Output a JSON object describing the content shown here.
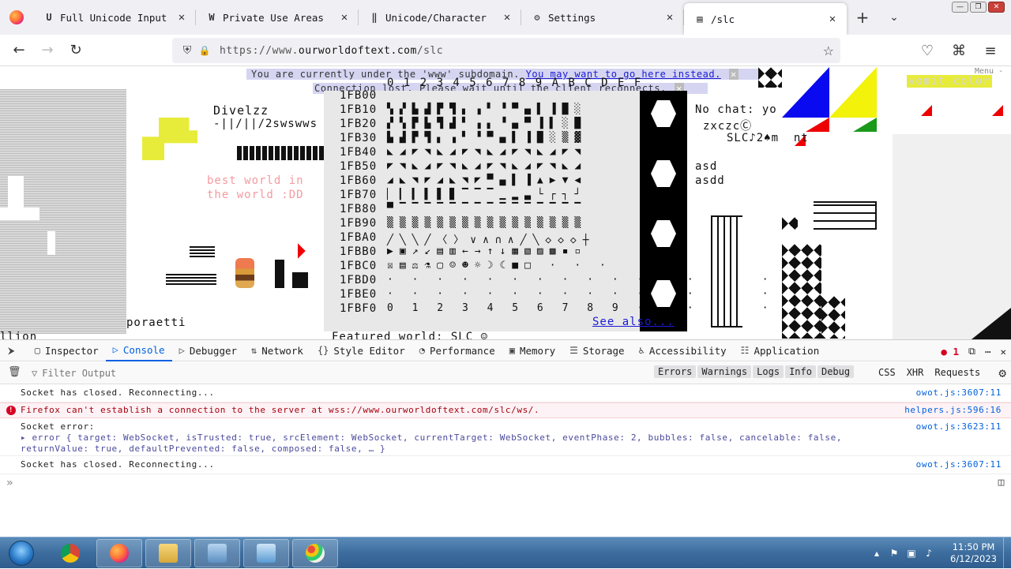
{
  "window_controls": [
    "—",
    "❐",
    "✕"
  ],
  "tabs": [
    {
      "label": "Full Unicode Input",
      "icon": "unicode-input-icon",
      "glyph": "U",
      "active": false
    },
    {
      "label": "Private Use Areas",
      "icon": "wikipedia-icon",
      "glyph": "W",
      "active": false
    },
    {
      "label": "Unicode/Character",
      "icon": "wiki-icon",
      "glyph": "‖",
      "active": false
    },
    {
      "label": "Settings",
      "icon": "gear-icon",
      "glyph": "⚙",
      "active": false
    },
    {
      "label": "/slc",
      "icon": "owot-icon",
      "glyph": "▤",
      "active": true
    }
  ],
  "tab_close": "✕",
  "tab_add": "+",
  "tab_list": "⌄",
  "nav": {
    "back": "←",
    "forward": "→",
    "reload": "↻",
    "url_prefix": "https://www.",
    "url_domain": "ourworldoftext.com",
    "url_path": "/slc",
    "shield": "⛨",
    "lock": "🔒",
    "star": "☆",
    "pocket": "♡",
    "extensions": "⌘",
    "menu": "≡"
  },
  "page": {
    "banner_text": "You are currently under the 'www' subdomain.",
    "banner_link": "You may want to go here instead.",
    "banner2_text": "Connection lost. Please wait until the client reconnects.",
    "banner_close": "✕",
    "divelzz": "Divelzz",
    "divelzz_sub": "-||/||/2swswws",
    "best_world_1": "best world in",
    "best_world_2": "the world :DD",
    "poraetti": "poraetti",
    "llion": "llion",
    "featured": "Featured world: SLC ☺",
    "see_also": "See also...",
    "no_chat": "No chat: yo",
    "zxczc": "zxczcⒸ",
    "slc_line": "SLC♪2♠m  nt",
    "asd": "asd",
    "asdd": "asdd",
    "vomit": "vomit color",
    "menu_label": "Menu -",
    "header_row": "0 1 2 3 4 5 6 7 8 9 A B C D E F",
    "rows": [
      {
        "code": "1FB00",
        "glyphs": ""
      },
      {
        "code": "1FB10",
        "glyphs": "▚▞▙▟▛▜▖▗▘▝▀▄▌▐█░"
      },
      {
        "code": "1FB20",
        "glyphs": "▞▚▛▙▜▟▘▗▖▝▄▀▐▌░█"
      },
      {
        "code": "1FB30",
        "glyphs": "▙▟▛▜▖▗▘▝▀▄▌▐█░▒▓"
      },
      {
        "code": "1FB40",
        "glyphs": "◣◢◤◥◣◢◤◥◣◢◤◥◣◢◤◥"
      },
      {
        "code": "1FB50",
        "glyphs": "◤◥◣◢◤◥◣◢◤◥◣◢◤◥◣◢"
      },
      {
        "code": "1FB60",
        "glyphs": "◢◣◥◤◢◣◥◤▀▄▌▐▲▶▼◀"
      },
      {
        "code": "1FB70",
        "glyphs": "▏▎▍▌▋▊▔▔▔▁▂▃└┌┐┘"
      },
      {
        "code": "1FB80",
        "glyphs": "▀▔▔▔▔▔▔▔▔▔▔▔▔▔▔▔"
      },
      {
        "code": "1FB90",
        "glyphs": "▒▒▒▒▒▒▒▒▒▒▒▒▒▒▒▒"
      },
      {
        "code": "1FBA0",
        "glyphs": "╱╲╲╱〈〉∨∧∩∧╱╲◇◇◇┼"
      },
      {
        "code": "1FBB0",
        "glyphs": "▶▣↗↙▤▥←→↑↓▦▧▨▩▪▫"
      },
      {
        "code": "1FBC0",
        "glyphs": "☒▤⚖⚗▢☺☻☼☽☾■□ · · ·"
      },
      {
        "code": "1FBD0",
        "glyphs": "· · · · · · · · · · · · · · · ·"
      },
      {
        "code": "1FBE0",
        "glyphs": "· · · · · · · · · · · · · · · ·"
      },
      {
        "code": "1FBF0",
        "glyphs": "0 1 2 3 4 5 6 7 8 9 · · · · · ·"
      }
    ]
  },
  "devtools": {
    "tabs": [
      {
        "label": "Inspector",
        "icon": "▢",
        "name": "inspector"
      },
      {
        "label": "Console",
        "icon": "▷",
        "name": "console",
        "active": true
      },
      {
        "label": "Debugger",
        "icon": "▷",
        "name": "debugger"
      },
      {
        "label": "Network",
        "icon": "⇅",
        "name": "network"
      },
      {
        "label": "Style Editor",
        "icon": "{}",
        "name": "style-editor"
      },
      {
        "label": "Performance",
        "icon": "◔",
        "name": "performance"
      },
      {
        "label": "Memory",
        "icon": "▣",
        "name": "memory"
      },
      {
        "label": "Storage",
        "icon": "☰",
        "name": "storage"
      },
      {
        "label": "Accessibility",
        "icon": "♿",
        "name": "accessibility"
      },
      {
        "label": "Application",
        "icon": "☷",
        "name": "application"
      }
    ],
    "error_count": "1",
    "pick_icon": "⮞",
    "filter_placeholder": "Filter Output",
    "filter_buttons": [
      "Errors",
      "Warnings",
      "Logs",
      "Info",
      "Debug"
    ],
    "filter_buttons2": [
      "CSS",
      "XHR",
      "Requests"
    ],
    "messages": [
      {
        "type": "log",
        "text": "Socket has closed. Reconnecting...",
        "source": "owot.js:3607:11"
      },
      {
        "type": "error",
        "text": "Firefox can't establish a connection to the server at wss://www.ourworldoftext.com/slc/ws/.",
        "source": "helpers.js:596:16"
      },
      {
        "type": "log",
        "text": "Socket error:",
        "source": "owot.js:3623:11",
        "detail_1": "▸ error { target: WebSocket, isTrusted: true, srcElement: WebSocket, currentTarget: WebSocket, eventPhase: 2, bubbles: false, cancelable: false,",
        "detail_2": "returnValue: true, defaultPrevented: false, composed: false, … }"
      },
      {
        "type": "log",
        "text": "Socket has closed. Reconnecting...",
        "source": "owot.js:3607:11"
      }
    ],
    "prompt": "»"
  },
  "taskbar": {
    "time": "11:50 PM",
    "date": "6/12/2023",
    "apps": [
      "chrome-icon",
      "firefox-icon",
      "explorer-icon",
      "control-panel-icon",
      "photo-viewer-icon",
      "paint-icon"
    ]
  },
  "colors": {
    "accent": "#0060df",
    "error": "#d70022",
    "taskbar": "#3d6d9e"
  }
}
